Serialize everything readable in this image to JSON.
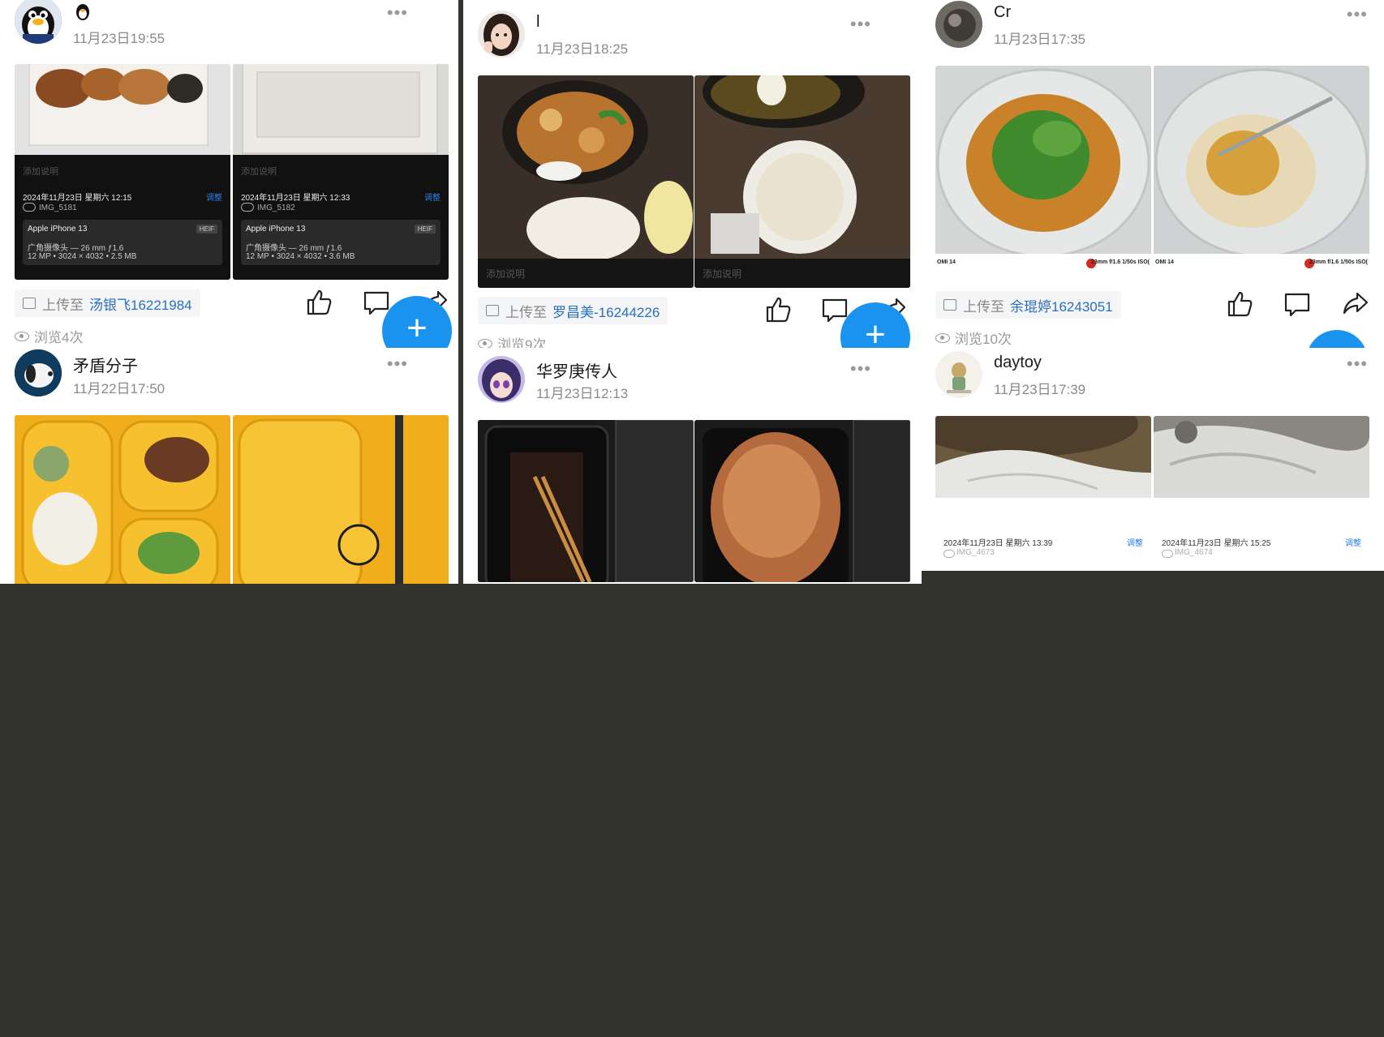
{
  "strips": {
    "a": {
      "top": {
        "post": {
          "author": "",
          "time": "11月23日19:55"
        },
        "photos": [
          {
            "note": "添加说明",
            "datetime": "2024年11月23日 星期六 12:15",
            "adjust": "调整",
            "filename": "IMG_5181",
            "device": "Apple iPhone 13",
            "format": "HEIF",
            "lens": "广角摄像头 — 26 mm ƒ1.6",
            "spec": "12 MP • 3024 × 4032 • 2.5 MB"
          },
          {
            "note": "添加说明",
            "datetime": "2024年11月23日 星期六 12:33",
            "adjust": "调整",
            "filename": "IMG_5182",
            "device": "Apple iPhone 13",
            "format": "HEIF",
            "lens": "广角摄像头 — 26 mm ƒ1.6",
            "spec": "12 MP • 3024 × 4032 • 3.6 MB"
          }
        ],
        "upload": {
          "prefix": "上传至",
          "target": "汤银飞16221984"
        },
        "views": "浏览4次"
      },
      "bottom": {
        "post": {
          "author": "矛盾分子",
          "time": "11月22日17:50"
        }
      }
    },
    "b": {
      "top": {
        "post": {
          "author": "l",
          "time": "11月23日18:25"
        },
        "photos": [
          {
            "note": "添加说明"
          },
          {
            "note": "添加说明"
          }
        ],
        "upload": {
          "prefix": "上传至",
          "target": "罗昌美-16244226"
        },
        "views": "浏览9次"
      },
      "bottom": {
        "post": {
          "author": "华罗庚传人",
          "time": "11月23日12:13"
        }
      }
    },
    "c": {
      "top": {
        "post": {
          "author": "Cr",
          "time": "11月23日17:35"
        },
        "photos": [
          {
            "model": "OMI 14",
            "exif": "23mm f/1.6 1/50s ISO("
          },
          {
            "model": "OMI 14",
            "exif": "23mm f/1.6 1/50s ISO("
          }
        ],
        "upload": {
          "prefix": "上传至",
          "target": "余琨婷16243051"
        },
        "views": "浏览10次"
      },
      "bottom": {
        "post": {
          "author": "daytoy",
          "time": "11月23日17:39"
        },
        "photos": [
          {
            "datetime": "2024年11月23日 星期六 13:39",
            "adjust": "调整",
            "filename": "IMG_4673"
          },
          {
            "datetime": "2024年11月23日 星期六 15:25",
            "adjust": "调整",
            "filename": "IMG_4674"
          }
        ]
      }
    }
  },
  "more_glyph": "•••",
  "fab_glyph": "+",
  "colors": {
    "accent": "#1a93ee",
    "link": "#2b6fbf",
    "backdrop": "#31332c"
  },
  "icons": [
    "penguin-icon",
    "image-icon",
    "eye-icon",
    "thumbs-up-icon",
    "comment-icon",
    "share-icon",
    "more-icon",
    "plus-icon",
    "leica-icon",
    "cloud-icon"
  ]
}
